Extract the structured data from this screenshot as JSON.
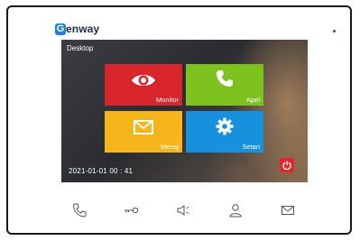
{
  "brand": {
    "mark": "G",
    "text": "enway",
    "color": "#1f7fd9"
  },
  "screen": {
    "title": "Desktop",
    "datetime": "2021-01-01  00 : 41"
  },
  "tiles": [
    {
      "label": "Monitor",
      "icon": "eye-icon",
      "color": "#d9262c"
    },
    {
      "label": "Apel",
      "icon": "phone-icon",
      "color": "#7dc21e"
    },
    {
      "label": "Mesaj",
      "icon": "envelope-icon",
      "color": "#f7b51c"
    },
    {
      "label": "Setari",
      "icon": "gear-icon",
      "color": "#1790de"
    }
  ],
  "power_button": {
    "icon": "power-icon",
    "color": "#e3262b"
  },
  "hardware_buttons": [
    {
      "icon": "phone-icon"
    },
    {
      "icon": "key-icon"
    },
    {
      "icon": "speaker-icon"
    },
    {
      "icon": "user-icon"
    },
    {
      "icon": "envelope-icon"
    }
  ]
}
